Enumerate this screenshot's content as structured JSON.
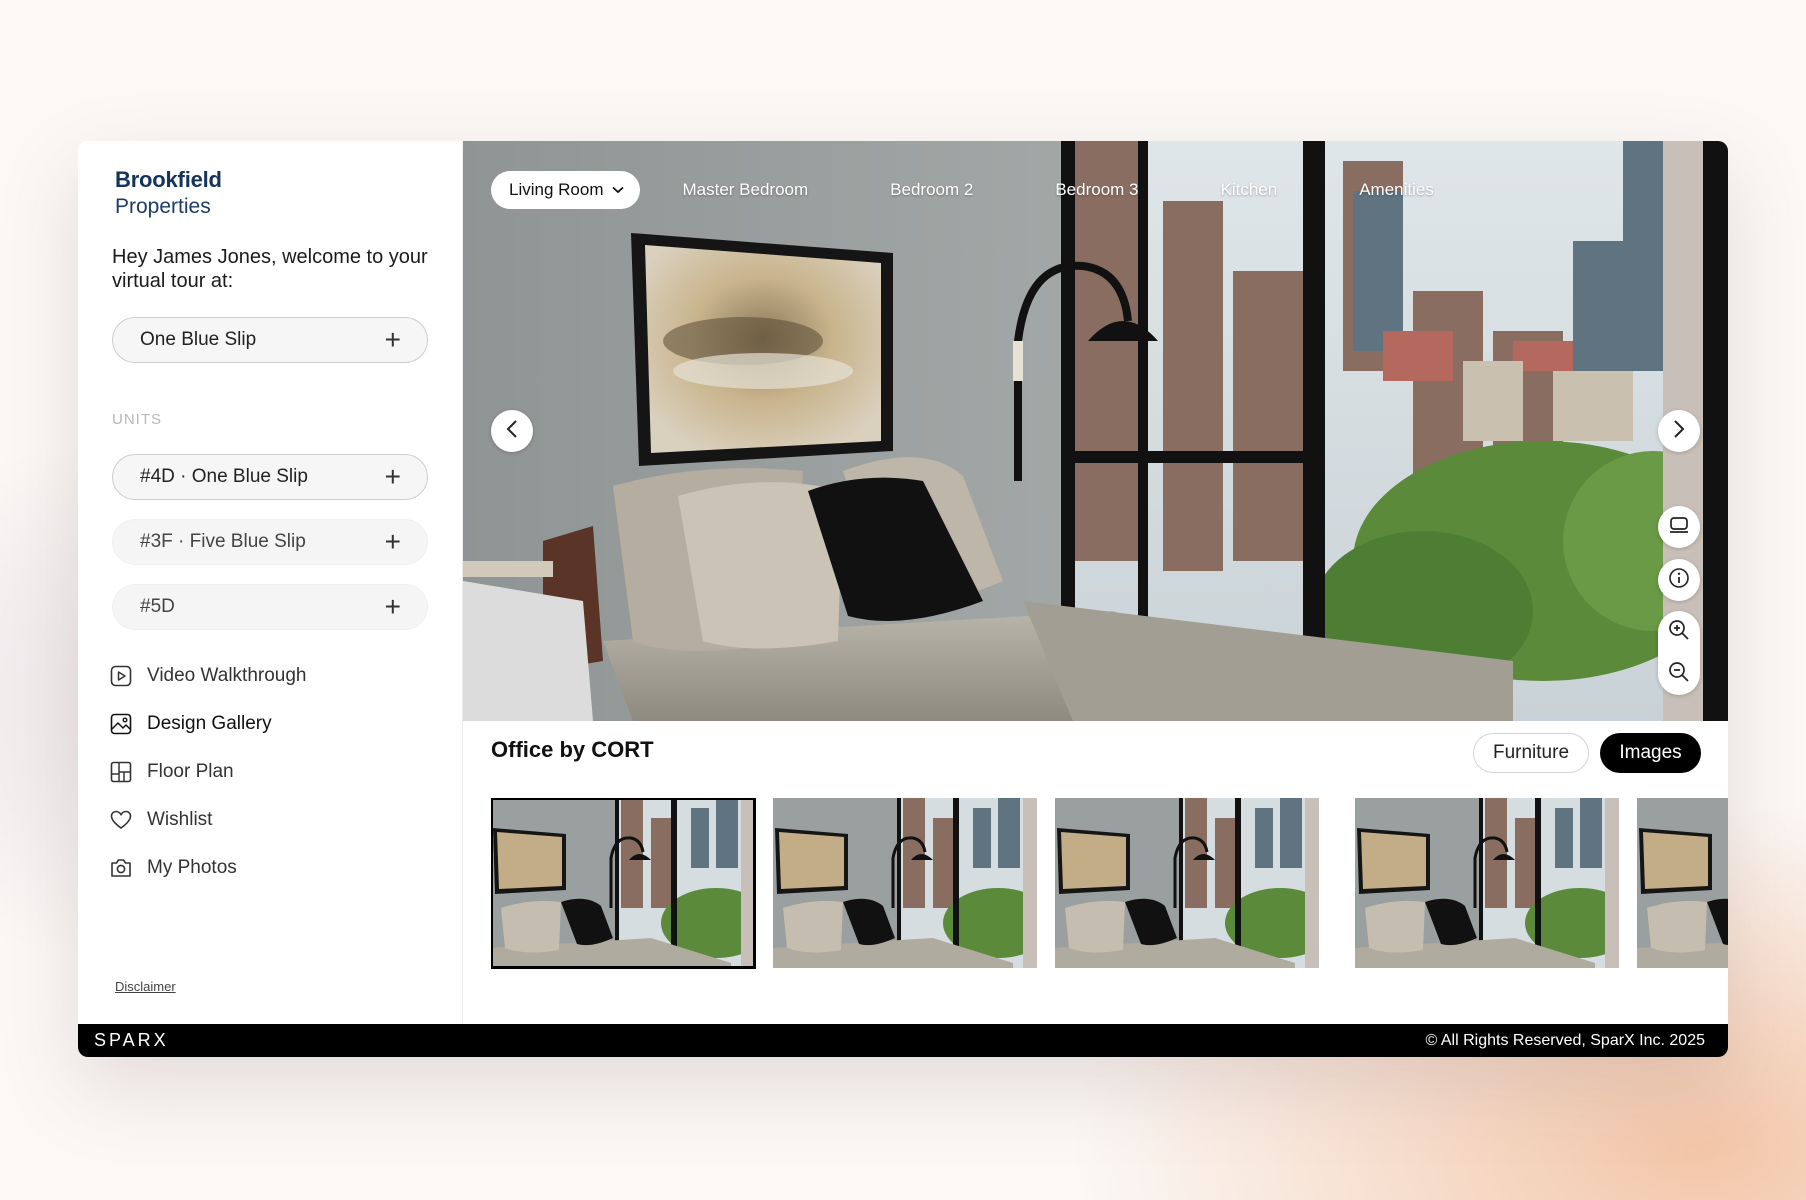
{
  "brand": {
    "line1": "Brookfield",
    "line2": "Properties"
  },
  "welcome": "Hey James Jones, welcome to your virtual tour at:",
  "property": {
    "label": "One Blue Slip",
    "action_icon": "plus-icon"
  },
  "units": {
    "heading": "UNITS",
    "items": [
      {
        "label": "#4D · One Blue Slip",
        "selected": true
      },
      {
        "label": "#3F · Five Blue Slip",
        "selected": false
      },
      {
        "label": "#5D",
        "selected": false
      }
    ]
  },
  "nav": [
    {
      "label": "Video Walkthrough",
      "icon": "play-icon",
      "active": false
    },
    {
      "label": "Design Gallery",
      "icon": "image-icon",
      "active": true
    },
    {
      "label": "Floor Plan",
      "icon": "floor-plan-icon",
      "active": false
    },
    {
      "label": "Wishlist",
      "icon": "heart-icon",
      "active": false
    },
    {
      "label": "My Photos",
      "icon": "camera-icon",
      "active": false
    }
  ],
  "disclaimer": "Disclaimer",
  "rooms": {
    "active": "Living Room",
    "tabs": [
      "Master Bedroom",
      "Bedroom 2",
      "Bedroom 3",
      "Kitchen",
      "Amenities"
    ]
  },
  "gallery": {
    "title": "Office by CORT",
    "toggle": {
      "furniture": "Furniture",
      "images": "Images",
      "selected": "Images"
    },
    "thumbnail_count": 5,
    "selected_index": 0
  },
  "footer": {
    "logo": "SPARX",
    "copyright": "© All Rights Reserved, SparX Inc. 2025"
  },
  "colors": {
    "brand_navy": "#14345a",
    "footer_bg": "#000000",
    "accent_black": "#000000"
  }
}
